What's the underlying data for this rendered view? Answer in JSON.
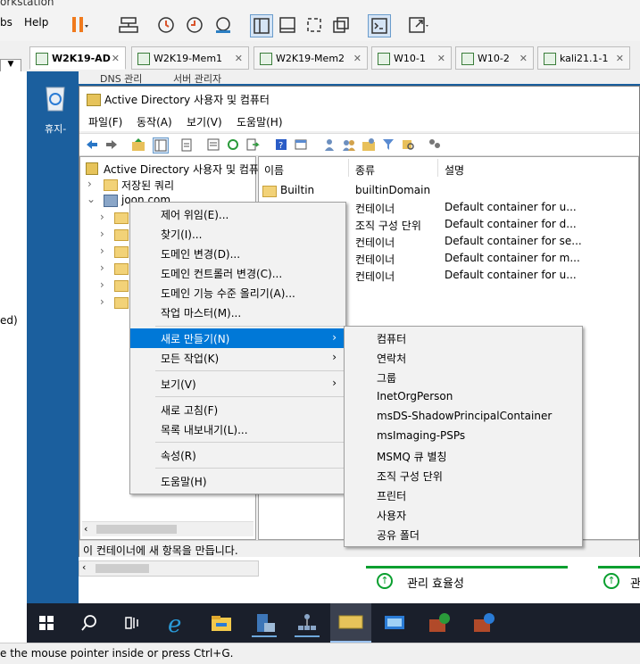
{
  "host": {
    "title_fragment": "orkstation",
    "menu": [
      "bs",
      "Help"
    ],
    "tabs": [
      {
        "label": "W2K19-AD",
        "active": true
      },
      {
        "label": "W2K19-Mem1",
        "active": false
      },
      {
        "label": "W2K19-Mem2",
        "active": false
      },
      {
        "label": "W10-1",
        "active": false
      },
      {
        "label": "W10-2",
        "active": false
      },
      {
        "label": "kali21.1-1",
        "active": false
      }
    ],
    "left_fragment": "ed)",
    "status_text": "e the mouse pointer inside or press Ctrl+G."
  },
  "guest": {
    "recycle_label": "휴지-",
    "bg_title_1": "DNS 관리",
    "bg_title_2": "서버 관리자"
  },
  "aduc": {
    "title": "Active Directory 사용자 및 컴퓨터",
    "menu": [
      "파일(F)",
      "동작(A)",
      "보기(V)",
      "도움말(H)"
    ],
    "tree": [
      "Active Directory 사용자 및 컴퓨",
      "저장된 쿼리",
      "joon.com"
    ],
    "columns": [
      "이름",
      "종류",
      "설명"
    ],
    "rows": [
      {
        "name": "Builtin",
        "type": "builtinDomain",
        "desc": ""
      },
      {
        "name": "",
        "type": "컨테이너",
        "desc": "Default container for u..."
      },
      {
        "name": "",
        "type": "조직 구성 단위",
        "desc": "Default container for d..."
      },
      {
        "name": "",
        "type": "컨테이너",
        "desc": "Default container for se..."
      },
      {
        "name": "",
        "type": "컨테이너",
        "desc": "Default container for m..."
      },
      {
        "name": "",
        "type": "컨테이너",
        "desc": "Default container for u..."
      }
    ],
    "status": "이 컨테이너에 새 항목을 만듭니다.",
    "admin_tools_label": "관리 효율성",
    "admin_tools_label_2": "관"
  },
  "context_menu": {
    "items": [
      "제어 위임(E)...",
      "찾기(I)...",
      "도메인 변경(D)...",
      "도메인 컨트롤러 변경(C)...",
      "도메인 기능 수준 올리기(A)...",
      "작업 마스터(M)...",
      "새로 만들기(N)",
      "모든 작업(K)",
      "보기(V)",
      "새로 고침(F)",
      "목록 내보내기(L)...",
      "속성(R)",
      "도움말(H)"
    ]
  },
  "submenu": {
    "items": [
      "컴퓨터",
      "연락처",
      "그룹",
      "InetOrgPerson",
      "msDS-ShadowPrincipalContainer",
      "msImaging-PSPs",
      "MSMQ 큐 별칭",
      "조직 구성 단위",
      "프린터",
      "사용자",
      "공유 폴더"
    ]
  },
  "colors": {
    "accent": "#0078d7",
    "desktop": "#1b5f9e",
    "taskbar": "#1a1f2b",
    "admin_green": "#0a9f2f"
  }
}
